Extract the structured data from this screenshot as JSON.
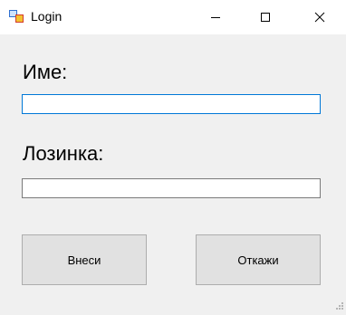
{
  "window": {
    "title": "Login",
    "icon": "windows-forms-app-icon"
  },
  "titlebar_buttons": {
    "minimize_icon": "minimize-icon",
    "maximize_icon": "maximize-icon",
    "close_icon": "close-icon"
  },
  "form": {
    "name_label": "Име:",
    "name_value": "",
    "password_label": "Лозинка:",
    "password_value": "",
    "ok_label": "Внеси",
    "cancel_label": "Откажи"
  },
  "colors": {
    "focus_border": "#0078d7",
    "background": "#f0f0f0",
    "button_face": "#e1e1e1"
  }
}
